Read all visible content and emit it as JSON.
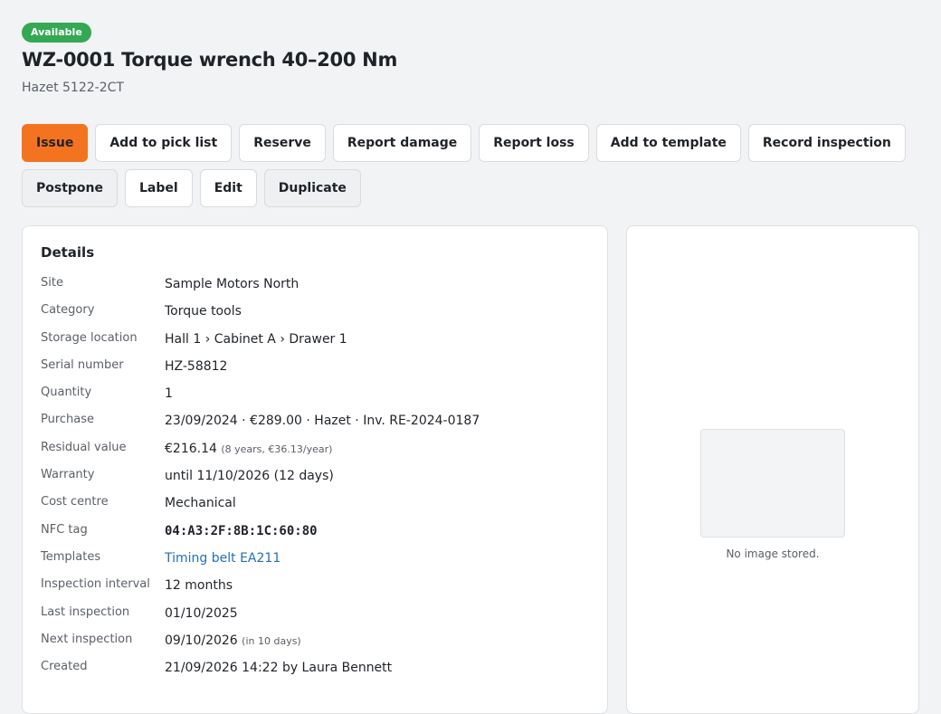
{
  "status_badge": "Available",
  "item": {
    "title": "WZ-0001 Torque wrench 40–200 Nm",
    "subtitle": "Hazet 5122-2CT"
  },
  "actions_row1": [
    "Issue",
    "Add to pick list",
    "Reserve",
    "Report damage",
    "Report loss",
    "Add to template",
    "Record inspection"
  ],
  "actions_row2": [
    "Postpone",
    "Label",
    "Edit",
    "Duplicate"
  ],
  "details": {
    "heading": "Details",
    "rows": [
      {
        "label": "Site",
        "value": "Sample Motors North"
      },
      {
        "label": "Category",
        "value": "Torque tools"
      },
      {
        "label": "Storage location",
        "value": "Hall 1 › Cabinet A › Drawer 1"
      },
      {
        "label": "Serial number",
        "value": "HZ-58812"
      },
      {
        "label": "Quantity",
        "value": "1"
      },
      {
        "label": "Purchase",
        "value": "23/09/2024 · €289.00 · Hazet · Inv. RE-2024-0187"
      },
      {
        "label": "Residual value",
        "value": "€216.14",
        "note": "(8 years, €36.13/year)"
      },
      {
        "label": "Warranty",
        "value": "until 11/10/2026 (12 days)"
      },
      {
        "label": "Cost centre",
        "value": "Mechanical"
      },
      {
        "label": "NFC tag",
        "value": "04:A3:2F:8B:1C:60:80"
      },
      {
        "label": "Templates",
        "value": "Timing belt EA211"
      },
      {
        "label": "Inspection interval",
        "value": "12 months"
      },
      {
        "label": "Last inspection",
        "value": "01/10/2025"
      },
      {
        "label": "Next inspection",
        "value": "09/10/2026",
        "note": "(in 10 days)"
      },
      {
        "label": "Created",
        "value": "21/09/2026 14:22 by Laura Bennett"
      }
    ]
  },
  "image": {
    "caption": "No image stored."
  },
  "colors": {
    "badge": "#34a853",
    "primary": "#f47320",
    "link": "#2470b8"
  }
}
